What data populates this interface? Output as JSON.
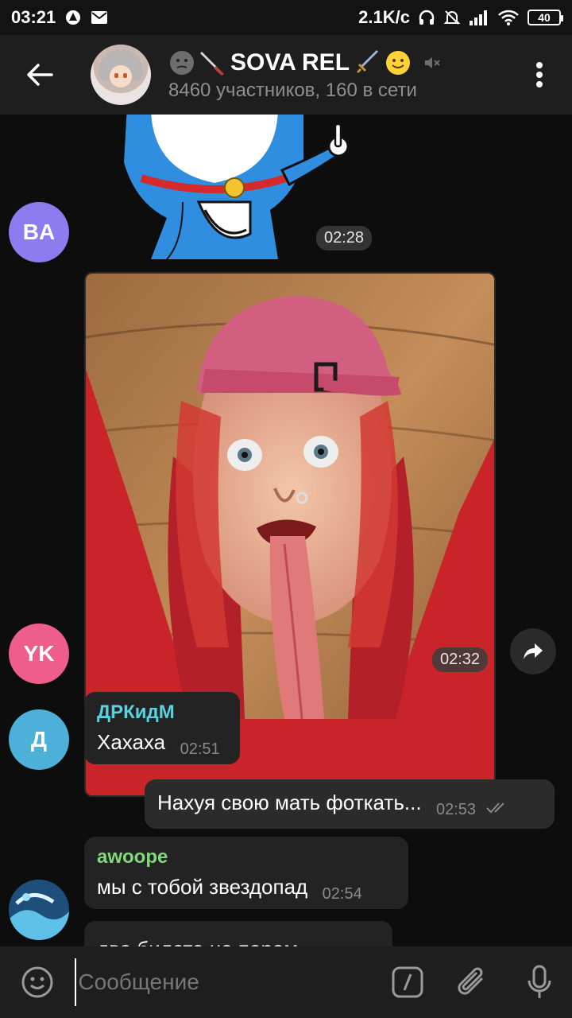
{
  "status": {
    "time": "03:21",
    "speed": "2.1K/c",
    "battery": "40"
  },
  "header": {
    "title": "SOVA REL",
    "subtitle": "8460 участников, 160 в сети"
  },
  "messages": {
    "sticker": {
      "avatar_initials": "BA",
      "time": "02:28"
    },
    "photo": {
      "avatar_initials": "YK",
      "time": "02:32"
    },
    "m1": {
      "avatar_initials": "Д",
      "sender": "ДРКидМ",
      "text": "Хахаха",
      "time": "02:51"
    },
    "m2": {
      "text": "Нахуя свою мать фоткать...",
      "time": "02:53"
    },
    "m3": {
      "sender": "awoope",
      "text": "мы с тобой звездопад",
      "time": "02:54"
    },
    "m4": {
      "text": "два билета на паром"
    }
  },
  "input": {
    "placeholder": "Сообщение"
  },
  "colors": {
    "avatar_ba": "#8b7cf0",
    "avatar_yk": "#ef5d8a",
    "avatar_d": "#4cb0d8",
    "sender_drkidm": "#5ad2e0",
    "sender_awoope": "#82d97a"
  }
}
